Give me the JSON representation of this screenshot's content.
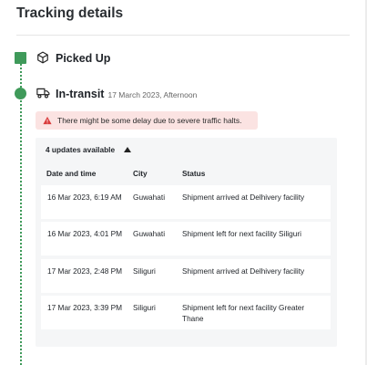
{
  "header": {
    "title": "Tracking details"
  },
  "steps": {
    "picked": {
      "title": "Picked Up",
      "icon": "package-icon"
    },
    "transit": {
      "title": "In-transit",
      "subtitle": "17 March 2023, Afternoon",
      "icon": "truck-icon"
    }
  },
  "alert": {
    "text": "There might be some delay due to severe traffic halts.",
    "icon": "warning-icon",
    "color": "#d93b3b",
    "background": "#fbe3e2"
  },
  "updates": {
    "toggle_label": "4 updates available",
    "expanded": true,
    "columns": {
      "date": "Date and time",
      "city": "City",
      "status": "Status"
    },
    "rows": [
      {
        "date": "16 Mar 2023, 6:19 AM",
        "city": "Guwahati",
        "status": "Shipment arrived at Delhivery facility"
      },
      {
        "date": "16 Mar 2023, 4:01 PM",
        "city": "Guwahati",
        "status": "Shipment left for next facility Siliguri"
      },
      {
        "date": "17 Mar 2023, 2:48 PM",
        "city": "Siliguri",
        "status": "Shipment arrived at Delhivery facility"
      },
      {
        "date": "17 Mar 2023, 3:39 PM",
        "city": "Siliguri",
        "status": "Shipment left for next facility Greater Thane"
      }
    ]
  },
  "colors": {
    "timeline_green": "#3f9a5a",
    "panel_bg": "#f5f6f7"
  }
}
